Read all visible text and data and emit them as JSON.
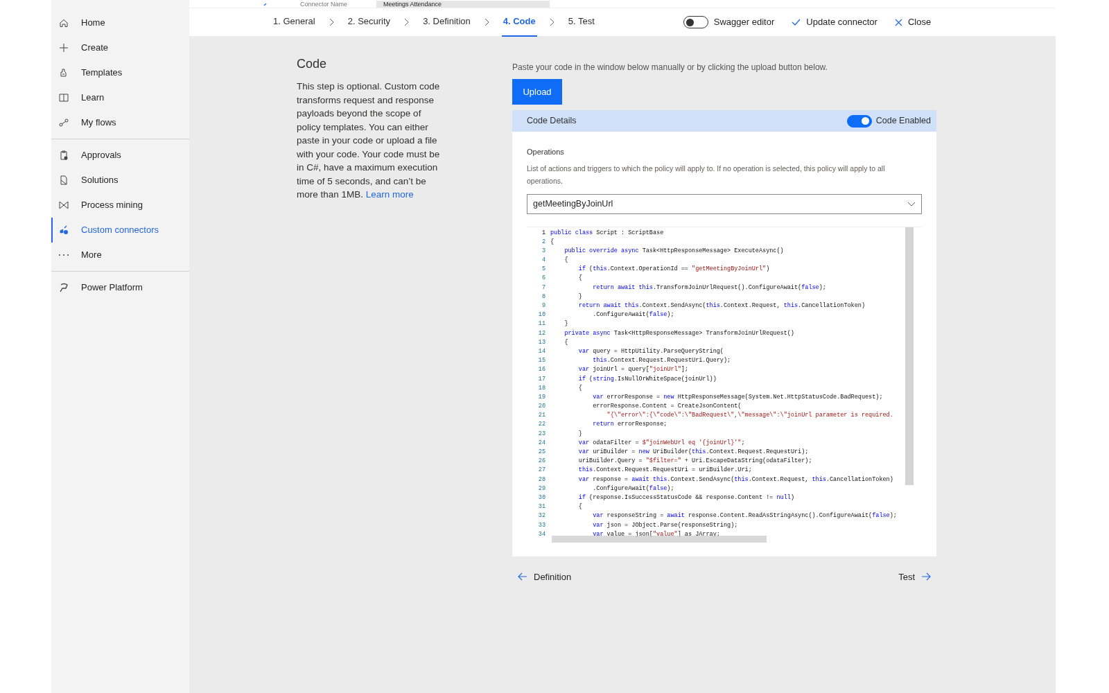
{
  "header_strip": {
    "connector_name_label": "Connector Name",
    "connector_name_value": "Meetings Attendance"
  },
  "sidebar": {
    "groups": [
      [
        {
          "label": "Home",
          "selected": false
        },
        {
          "label": "Create",
          "selected": false
        },
        {
          "label": "Templates",
          "selected": false
        },
        {
          "label": "Learn",
          "selected": false
        },
        {
          "label": "My flows",
          "selected": false
        }
      ],
      [
        {
          "label": "Approvals",
          "selected": false
        },
        {
          "label": "Solutions",
          "selected": false
        },
        {
          "label": "Process mining",
          "selected": false
        },
        {
          "label": "Custom connectors",
          "selected": true
        },
        {
          "label": "More",
          "selected": false
        }
      ],
      [
        {
          "label": "Power Platform",
          "selected": false
        }
      ]
    ]
  },
  "steps": [
    {
      "label": "1. General",
      "selected": false
    },
    {
      "label": "2. Security",
      "selected": false
    },
    {
      "label": "3. Definition",
      "selected": false
    },
    {
      "label": "4. Code",
      "selected": true
    },
    {
      "label": "5. Test",
      "selected": false
    }
  ],
  "toolbar": {
    "swagger_editor": {
      "label": "Swagger editor",
      "on": false
    },
    "update_label": "Update connector",
    "close_label": "Close"
  },
  "intro": {
    "title": "Code",
    "text": "This step is optional. Custom code transforms request and response payloads beyond the scope of policy templates. You can either paste in your code or upload a file with your code. Your code must be in C#, have a maximum execution time of 5 seconds, and can’t be more than 1MB.",
    "link": "Learn more"
  },
  "instructions": "Paste your code in the window below manually or by clicking the upload button below.",
  "upload_button": "Upload",
  "code_details": {
    "title": "Code Details",
    "toggle": {
      "label": "Code Enabled",
      "on": true
    },
    "operations_label": "Operations",
    "operations_help": "List of actions and triggers to which the policy will apply to. If no operation is selected, this policy will apply to all operations.",
    "operation_value": "getMeetingByJoinUrl",
    "code_lines": [
      {
        "num": "1",
        "tokens": [
          {
            "text": "public class",
            "kind": "keyword"
          },
          {
            "text": " Script : ScriptBase",
            "kind": "plain"
          }
        ]
      },
      {
        "num": "2",
        "tokens": [
          {
            "text": "{",
            "kind": "plain"
          }
        ]
      },
      {
        "num": "3",
        "tokens": [
          {
            "text": "    public override async",
            "kind": "keyword"
          },
          {
            "text": " Task<HttpResponseMessage> ExecuteAsync()",
            "kind": "plain"
          }
        ]
      },
      {
        "num": "4",
        "tokens": [
          {
            "text": "    {",
            "kind": "plain"
          }
        ]
      },
      {
        "num": "5",
        "tokens": [
          {
            "text": "        if",
            "kind": "keyword"
          },
          {
            "text": " (",
            "kind": "plain"
          },
          {
            "text": "this",
            "kind": "keyword"
          },
          {
            "text": ".Context.OperationId == ",
            "kind": "plain"
          },
          {
            "text": "\"getMeetingByJoinUrl\"",
            "kind": "string"
          },
          {
            "text": ")",
            "kind": "plain"
          }
        ]
      },
      {
        "num": "6",
        "tokens": [
          {
            "text": "        {",
            "kind": "plain"
          }
        ]
      },
      {
        "num": "7",
        "tokens": [
          {
            "text": "            return await this",
            "kind": "keyword"
          },
          {
            "text": ".TransformJoinUrlRequest().ConfigureAwait(",
            "kind": "plain"
          },
          {
            "text": "false",
            "kind": "keyword"
          },
          {
            "text": ");",
            "kind": "plain"
          }
        ]
      },
      {
        "num": "8",
        "tokens": [
          {
            "text": "        }",
            "kind": "plain"
          }
        ]
      },
      {
        "num": "9",
        "tokens": [
          {
            "text": "        return await this",
            "kind": "keyword"
          },
          {
            "text": ".Context.SendAsync(",
            "kind": "plain"
          },
          {
            "text": "this",
            "kind": "keyword"
          },
          {
            "text": ".Context.Request, ",
            "kind": "plain"
          },
          {
            "text": "this",
            "kind": "keyword"
          },
          {
            "text": ".CancellationToken)",
            "kind": "plain"
          }
        ]
      },
      {
        "num": "10",
        "tokens": [
          {
            "text": "            .ConfigureAwait(",
            "kind": "plain"
          },
          {
            "text": "false",
            "kind": "keyword"
          },
          {
            "text": ");",
            "kind": "plain"
          }
        ]
      },
      {
        "num": "11",
        "tokens": [
          {
            "text": "    }",
            "kind": "plain"
          }
        ]
      },
      {
        "num": "12",
        "tokens": [
          {
            "text": "    private async",
            "kind": "keyword"
          },
          {
            "text": " Task<HttpResponseMessage> TransformJoinUrlRequest()",
            "kind": "plain"
          }
        ]
      },
      {
        "num": "13",
        "tokens": [
          {
            "text": "    {",
            "kind": "plain"
          }
        ]
      },
      {
        "num": "14",
        "tokens": [
          {
            "text": "        var",
            "kind": "keyword"
          },
          {
            "text": " query = HttpUtility.ParseQueryString(",
            "kind": "plain"
          }
        ]
      },
      {
        "num": "15",
        "tokens": [
          {
            "text": "            this",
            "kind": "keyword"
          },
          {
            "text": ".Context.Request.RequestUri.Query);",
            "kind": "plain"
          }
        ]
      },
      {
        "num": "16",
        "tokens": [
          {
            "text": "        var",
            "kind": "keyword"
          },
          {
            "text": " joinUrl = query[",
            "kind": "plain"
          },
          {
            "text": "\"joinUrl\"",
            "kind": "string"
          },
          {
            "text": "];",
            "kind": "plain"
          }
        ]
      },
      {
        "num": "17",
        "tokens": [
          {
            "text": "        if",
            "kind": "keyword"
          },
          {
            "text": " (",
            "kind": "plain"
          },
          {
            "text": "string",
            "kind": "keyword"
          },
          {
            "text": ".IsNullOrWhiteSpace(joinUrl))",
            "kind": "plain"
          }
        ]
      },
      {
        "num": "18",
        "tokens": [
          {
            "text": "        {",
            "kind": "plain"
          }
        ]
      },
      {
        "num": "19",
        "tokens": [
          {
            "text": "            var",
            "kind": "keyword"
          },
          {
            "text": " errorResponse = ",
            "kind": "plain"
          },
          {
            "text": "new",
            "kind": "keyword"
          },
          {
            "text": " HttpResponseMessage(System.Net.HttpStatusCode.BadRequest);",
            "kind": "plain"
          }
        ]
      },
      {
        "num": "20",
        "tokens": [
          {
            "text": "            errorResponse.Content = CreateJsonContent(",
            "kind": "plain"
          }
        ]
      },
      {
        "num": "21",
        "tokens": [
          {
            "text": "                \"{\\\"error\\\":{\\\"code\\\":\\\"BadRequest\\\",\\\"message\\\":\\\"joinUrl parameter is required.",
            "kind": "string"
          }
        ]
      },
      {
        "num": "22",
        "tokens": [
          {
            "text": "            return",
            "kind": "keyword"
          },
          {
            "text": " errorResponse;",
            "kind": "plain"
          }
        ]
      },
      {
        "num": "23",
        "tokens": [
          {
            "text": "        }",
            "kind": "plain"
          }
        ]
      },
      {
        "num": "24",
        "tokens": [
          {
            "text": "        var",
            "kind": "keyword"
          },
          {
            "text": " odataFilter = ",
            "kind": "plain"
          },
          {
            "text": "$\"joinWebUrl eq '{joinUrl}'\"",
            "kind": "string"
          },
          {
            "text": ";",
            "kind": "plain"
          }
        ]
      },
      {
        "num": "25",
        "tokens": [
          {
            "text": "        var",
            "kind": "keyword"
          },
          {
            "text": " uriBuilder = ",
            "kind": "plain"
          },
          {
            "text": "new",
            "kind": "keyword"
          },
          {
            "text": " UriBuilder(",
            "kind": "plain"
          },
          {
            "text": "this",
            "kind": "keyword"
          },
          {
            "text": ".Context.Request.RequestUri);",
            "kind": "plain"
          }
        ]
      },
      {
        "num": "26",
        "tokens": [
          {
            "text": "        uriBuilder.Query = ",
            "kind": "plain"
          },
          {
            "text": "\"$filter=\"",
            "kind": "string"
          },
          {
            "text": " + Uri.EscapeDataString(odataFilter);",
            "kind": "plain"
          }
        ]
      },
      {
        "num": "27",
        "tokens": [
          {
            "text": "        this",
            "kind": "keyword"
          },
          {
            "text": ".Context.Request.RequestUri = uriBuilder.Uri;",
            "kind": "plain"
          }
        ]
      },
      {
        "num": "28",
        "tokens": [
          {
            "text": "        var",
            "kind": "keyword"
          },
          {
            "text": " response = ",
            "kind": "plain"
          },
          {
            "text": "await this",
            "kind": "keyword"
          },
          {
            "text": ".Context.SendAsync(",
            "kind": "plain"
          },
          {
            "text": "this",
            "kind": "keyword"
          },
          {
            "text": ".Context.Request, ",
            "kind": "plain"
          },
          {
            "text": "this",
            "kind": "keyword"
          },
          {
            "text": ".CancellationToken)",
            "kind": "plain"
          }
        ]
      },
      {
        "num": "29",
        "tokens": [
          {
            "text": "            .ConfigureAwait(",
            "kind": "plain"
          },
          {
            "text": "false",
            "kind": "keyword"
          },
          {
            "text": ");",
            "kind": "plain"
          }
        ]
      },
      {
        "num": "30",
        "tokens": [
          {
            "text": "        if",
            "kind": "keyword"
          },
          {
            "text": " (response.IsSuccessStatusCode && response.Content != ",
            "kind": "plain"
          },
          {
            "text": "null",
            "kind": "keyword"
          },
          {
            "text": ")",
            "kind": "plain"
          }
        ]
      },
      {
        "num": "31",
        "tokens": [
          {
            "text": "        {",
            "kind": "plain"
          }
        ]
      },
      {
        "num": "32",
        "tokens": [
          {
            "text": "            var",
            "kind": "keyword"
          },
          {
            "text": " responseString = ",
            "kind": "plain"
          },
          {
            "text": "await",
            "kind": "keyword"
          },
          {
            "text": " response.Content.ReadAsStringAsync().ConfigureAwait(",
            "kind": "plain"
          },
          {
            "text": "false",
            "kind": "keyword"
          },
          {
            "text": ");",
            "kind": "plain"
          }
        ]
      },
      {
        "num": "33",
        "tokens": [
          {
            "text": "            var",
            "kind": "keyword"
          },
          {
            "text": " json = JObject.Parse(responseString);",
            "kind": "plain"
          }
        ]
      },
      {
        "num": "34",
        "tokens": [
          {
            "text": "            var",
            "kind": "keyword"
          },
          {
            "text": " value = json[",
            "kind": "plain"
          },
          {
            "text": "\"value\"",
            "kind": "string"
          },
          {
            "text": "] as JArray;",
            "kind": "plain"
          }
        ]
      }
    ]
  },
  "footer": {
    "back_label": "Definition",
    "next_label": "Test"
  }
}
